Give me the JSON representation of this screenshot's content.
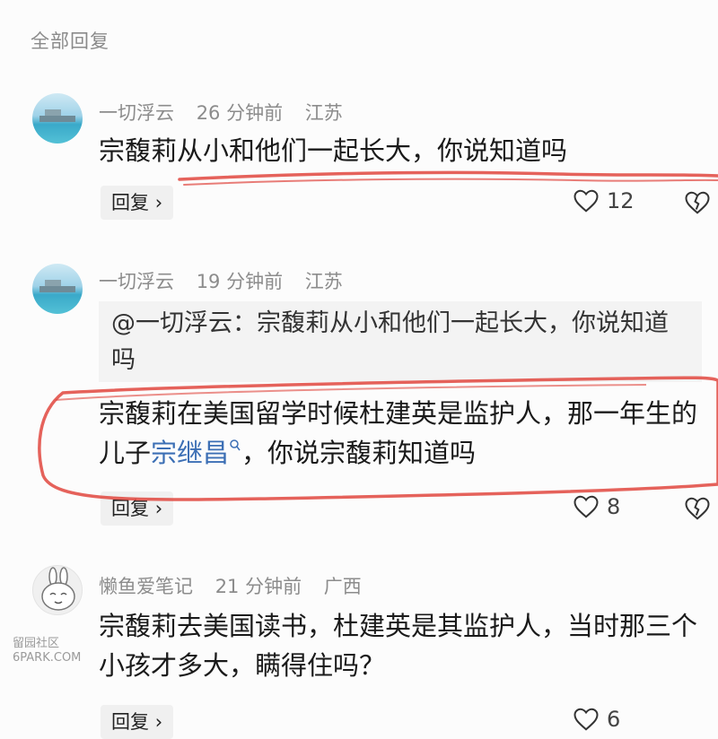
{
  "header": {
    "title": "全部回复"
  },
  "comments": [
    {
      "user": "一切浮云",
      "time": "26 分钟前",
      "location": "江苏",
      "text": "宗馥莉从小和他们一起长大，你说知道吗",
      "reply_label": "回复",
      "likes": "12",
      "avatar": "sea-pier-avatar"
    },
    {
      "user": "一切浮云",
      "time": "19 分钟前",
      "location": "江苏",
      "quote": "@一切浮云：宗馥莉从小和他们一起长大，你说知道吗",
      "text_part1": "宗馥莉在美国留学时候杜建英是监护人，那一年生的儿子",
      "topic_link": "宗继昌",
      "text_part2": "，你说宗馥莉知道吗",
      "reply_label": "回复",
      "likes": "8",
      "avatar": "sea-pier-avatar"
    },
    {
      "user": "懒鱼爱笔记",
      "time": "21 分钟前",
      "location": "广西",
      "text": "宗馥莉去美国读书，杜建英是其监护人，当时那三个小孩才多大，瞒得住吗？",
      "reply_label": "回复",
      "likes": "6",
      "avatar": "bunny-avatar"
    }
  ],
  "watermark": {
    "line1": "留园社区",
    "line2": "6PARK.COM"
  },
  "colors": {
    "annotation_red": "#e0463e",
    "topic_link": "#3c6fb5",
    "meta_gray": "#8c8c8c"
  }
}
